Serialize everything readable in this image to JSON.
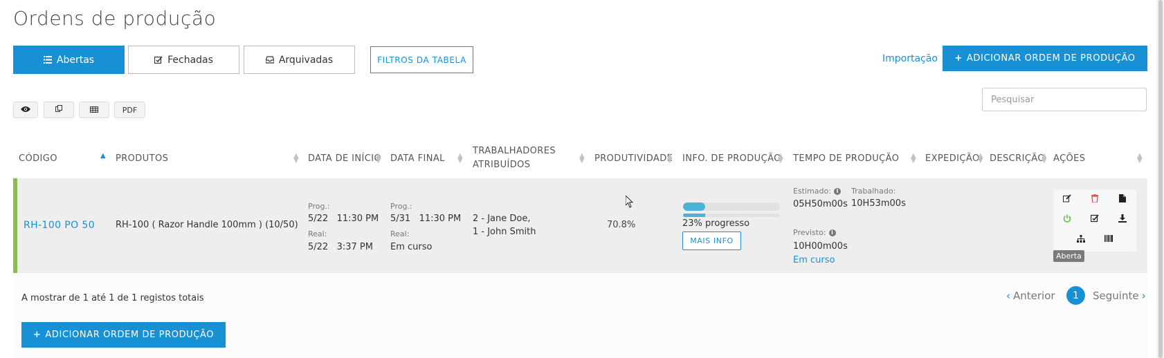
{
  "page": {
    "title": "Ordens de produção"
  },
  "tabs": [
    {
      "label": "Abertas",
      "icon": "list-icon",
      "active": true
    },
    {
      "label": "Fechadas",
      "icon": "check-square-icon",
      "active": false
    },
    {
      "label": "Arquivadas",
      "icon": "inbox-icon",
      "active": false
    }
  ],
  "filters_label": "FILTROS DA TABELA",
  "import_label": "Importação",
  "add_button_label": "ADICIONAR ORDEM DE PRODUÇÃO",
  "toolbar": {
    "pdf_label": "PDF",
    "icons": [
      "eye-icon",
      "copy-icon",
      "table-icon"
    ]
  },
  "search": {
    "placeholder": "Pesquisar"
  },
  "table": {
    "columns": [
      "CÓDIGO",
      "PRODUTOS",
      "DATA DE INÍCIO",
      "DATA FINAL",
      "TRABALHADORES ATRIBUÍDOS",
      "PRODUTIVIDADE",
      "INFO. DE PRODUÇÃO",
      "TEMPO DE PRODUÇÃO",
      "EXPEDIÇÃO",
      "DESCRIÇÃO",
      "AÇÕES"
    ],
    "sorted_column": "CÓDIGO",
    "rows": [
      {
        "code": "RH-100 PO 50",
        "product": "RH-100 ( Razor Handle 100mm ) (10/50)",
        "start": {
          "prog_label": "Prog.:",
          "prog_value": "5/22   11:30 PM",
          "real_label": "Real:",
          "real_value": "5/22   3:37 PM"
        },
        "end": {
          "prog_label": "Prog.:",
          "prog_value": "5/31   11:30 PM",
          "real_label": "Real:",
          "real_value": "Em curso"
        },
        "workers": [
          "2 - Jane Doe,",
          "1 - John Smith"
        ],
        "productivity": "70.8%",
        "progress_percent": 23,
        "progress_text": "23% progresso",
        "more_info_label": "MAIS INFO",
        "time": {
          "estimated_label": "Estimado:",
          "estimated_value": "05H50m00s",
          "worked_label": "Trabalhado:",
          "worked_value": "10H53m00s",
          "forecast_label": "Previsto:",
          "forecast_value": "10H00m00s",
          "status_link": "Em curso"
        },
        "action_icons": [
          "edit-icon",
          "delete-icon",
          "document-icon",
          "power-icon",
          "check-square-icon",
          "download-icon",
          "hierarchy-icon",
          "barcode-icon"
        ],
        "status_tooltip": "Aberta"
      }
    ]
  },
  "footer": {
    "summary": "A mostrar de 1 até 1 de 1 registos totais",
    "prev_label": "Anterior",
    "next_label": "Seguinte",
    "current_page": "1"
  },
  "colors": {
    "primary": "#1791d4",
    "row_accent": "#8cbc4f",
    "progress": "#4ab3d6",
    "delete": "#e05252",
    "power": "#6cc04a"
  }
}
